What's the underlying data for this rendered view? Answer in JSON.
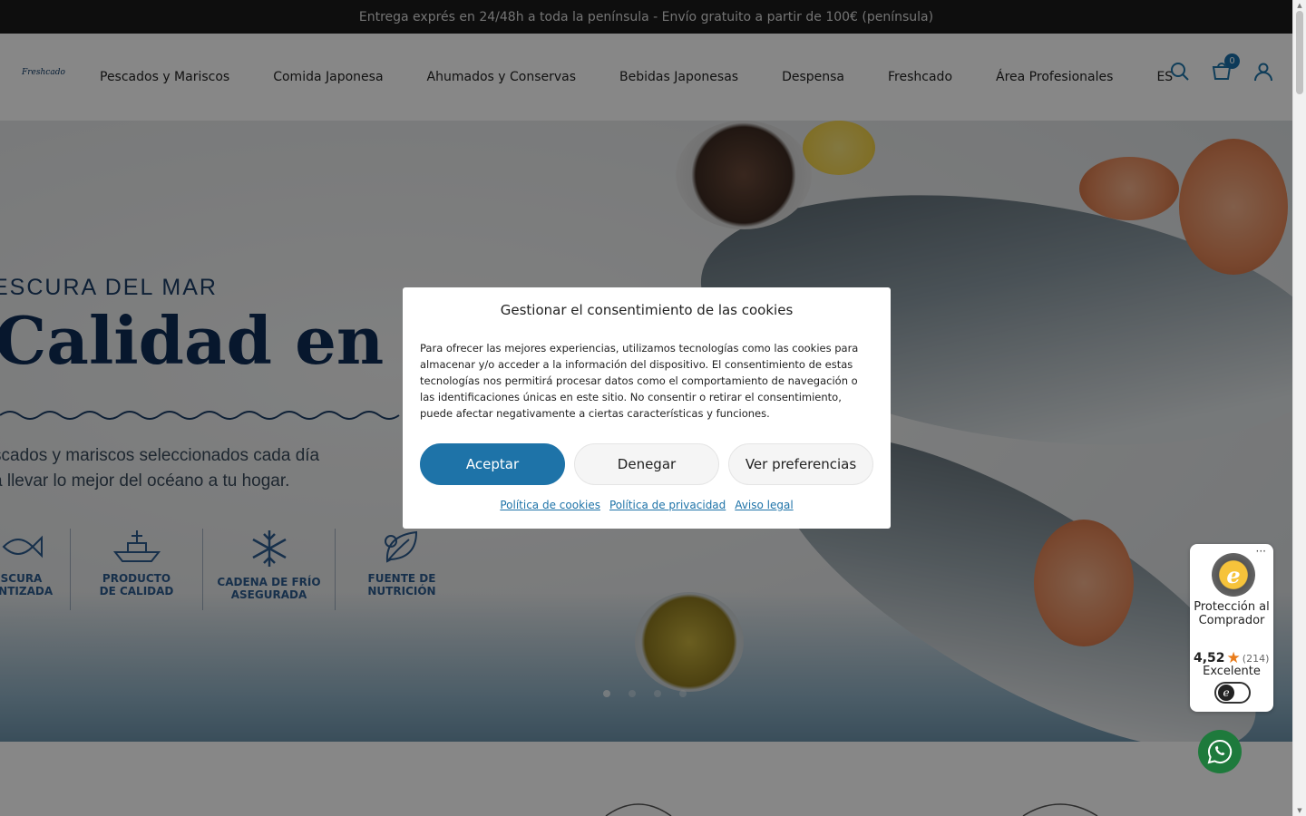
{
  "announcement": "Entrega exprés en 24/48h a toda la península - Envío gratuito a partir de 100€ (península)",
  "brand": "Freshcado",
  "nav": {
    "items": [
      "Pescados y Mariscos",
      "Comida Japonesa",
      "Ahumados y Conservas",
      "Bebidas Japonesas",
      "Despensa",
      "Freshcado",
      "Área Profesionales",
      "ES"
    ],
    "cart_count": "0"
  },
  "hero": {
    "eyebrow": "ESCURA DEL MAR",
    "headline": "Calidad en tu m",
    "subtext_line1": "scados y mariscos seleccionados cada día",
    "subtext_line2": "a llevar lo mejor del océano a tu hogar.",
    "features": [
      {
        "label": "SCURA\nANTIZADA",
        "icon": "fish-icon"
      },
      {
        "label": "PRODUCTO\nDE CALIDAD",
        "icon": "boat-icon"
      },
      {
        "label": "CADENA DE FRÍO\nASEGURADA",
        "icon": "snowflake-icon"
      },
      {
        "label": "FUENTE DE\nNUTRICIÓN",
        "icon": "leaf-icon"
      }
    ],
    "slides": 4,
    "active_slide": 1
  },
  "cookie_modal": {
    "title": "Gestionar el consentimiento de las cookies",
    "body": "Para ofrecer las mejores experiencias, utilizamos tecnologías como las cookies para almacenar y/o acceder a la información del dispositivo. El consentimiento de estas tecnologías nos permitirá procesar datos como el comportamiento de navegación o las identificaciones únicas en este sitio. No consentir o retirar el consentimiento, puede afectar negativamente a ciertas características y funciones.",
    "accept_label": "Aceptar",
    "deny_label": "Denegar",
    "preferences_label": "Ver preferencias",
    "links": [
      "Política de cookies",
      "Política de privacidad",
      "Aviso legal"
    ]
  },
  "trusted_shops": {
    "more": "···",
    "title": "Protección al Comprador",
    "score": "4,52",
    "count": "(214)",
    "label": "Excelente",
    "seal_letter": "e"
  },
  "colors": {
    "accent": "#1e73a8",
    "navy": "#0f2c55",
    "topbar": "#1c1c1c",
    "whatsapp": "#1e7a3c",
    "star": "#e97c1b"
  }
}
